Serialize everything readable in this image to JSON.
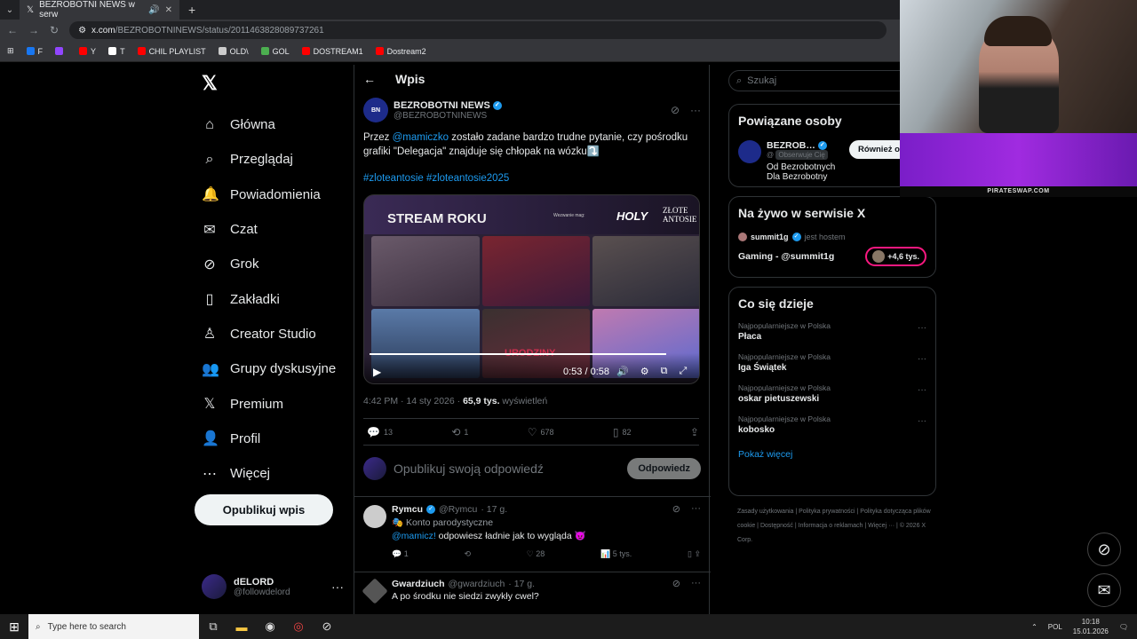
{
  "browser": {
    "tab_title": "BEZROBOTNI NEWS w serw",
    "url_host": "x.com",
    "url_path": "/BEZROBOTNINEWS/status/2011463828089737261",
    "bookmarks": [
      {
        "label": "F",
        "color": "#1877f2"
      },
      {
        "label": "",
        "color": "#9146ff"
      },
      {
        "label": "Y",
        "color": "#ff0000"
      },
      {
        "label": "T",
        "color": "#ffffff"
      },
      {
        "label": "CHIL PLAYLIST",
        "color": "#ff0000"
      },
      {
        "label": "OLD\\",
        "color": "#cccccc"
      },
      {
        "label": "GOL",
        "color": "#4caf50"
      },
      {
        "label": "DOSTREAM1",
        "color": "#ff0000"
      },
      {
        "label": "Dostream2",
        "color": "#ff0000"
      }
    ]
  },
  "nav": {
    "items": [
      {
        "icon": "⌂",
        "icon_name": "home-icon",
        "label": "Główna"
      },
      {
        "icon": "⌕",
        "icon_name": "search-icon",
        "label": "Przeglądaj"
      },
      {
        "icon": "🔔",
        "icon_name": "bell-icon",
        "label": "Powiadomienia"
      },
      {
        "icon": "✉",
        "icon_name": "mail-icon",
        "label": "Czat"
      },
      {
        "icon": "⊘",
        "icon_name": "grok-icon",
        "label": "Grok"
      },
      {
        "icon": "▯",
        "icon_name": "bookmark-icon",
        "label": "Zakładki"
      },
      {
        "icon": "♙",
        "icon_name": "creator-icon",
        "label": "Creator Studio"
      },
      {
        "icon": "👥",
        "icon_name": "groups-icon",
        "label": "Grupy dyskusyjne"
      },
      {
        "icon": "𝕏",
        "icon_name": "premium-icon",
        "label": "Premium"
      },
      {
        "icon": "👤",
        "icon_name": "profile-icon",
        "label": "Profil"
      },
      {
        "icon": "⋯",
        "icon_name": "more-icon",
        "label": "Więcej"
      }
    ],
    "post_button": "Opublikuj wpis",
    "me": {
      "name": "dELORD",
      "handle": "@followdelord"
    }
  },
  "post": {
    "header": "Wpis",
    "author": "BEZROBOTNI NEWS",
    "handle": "@BEZROBOTNINEWS",
    "avatar_text": "BN",
    "text_pre": "Przez ",
    "mention": "@mamiczko",
    "text_post": " zostało zadane bardzo trudne pytanie, czy pośrodku grafiki \"Delegacja\" znajduje się chłopak na wózku⤵️",
    "hashtags": "#zloteantosie #zloteantosie2025",
    "media": {
      "title": "STREAM ROKU",
      "subtitle": "Wezwanie mag:",
      "brand": "HOLY",
      "brand2": "ZŁOTE ANTOSIE",
      "overlay_text": "URODZINY",
      "time": "0:53 / 0:58",
      "progress": 0.91
    },
    "time": "4:42 PM · 14 sty 2026 · ",
    "views": "65,9 tys.",
    "views_label": " wyświetleń",
    "stats": {
      "replies": "13",
      "reposts": "1",
      "likes": "678",
      "bookmarks": "82"
    },
    "reply_placeholder": "Opublikuj swoją odpowiedź",
    "reply_button": "Odpowiedz"
  },
  "replies": [
    {
      "name": "Rymcu",
      "handle": "@Rymcu",
      "time": "· 17 g.",
      "sub": "🎭 Konto parodystyczne",
      "mention": "@mamicz!",
      "text": " odpowiesz ładnie jak to wygląda 😈",
      "stats": {
        "replies": "1",
        "reposts": "",
        "likes": "28",
        "views": "5 tys."
      }
    },
    {
      "name": "Gwardziuch",
      "handle": "@gwardziuch",
      "time": "· 17 g.",
      "text": "A po środku nie siedzi zwykły cwel?"
    }
  ],
  "right": {
    "search_placeholder": "Szukaj",
    "related": {
      "title": "Powiązane osoby",
      "name": "BEZROB…",
      "follows_you": "Obserwuje Cię",
      "button": "Również obser",
      "bio": "Od Bezrobotnych Dla Bezrobotny"
    },
    "live": {
      "title": "Na żywo w serwisie X",
      "host": "summit1g",
      "host_label": "jest hostem",
      "stream": "Gaming - @summit1g",
      "count": "+4,6 tys."
    },
    "trends": {
      "title": "Co się dzieje",
      "items": [
        {
          "context": "Najpopularniejsze w Polska",
          "name": "Płaca"
        },
        {
          "context": "Najpopularniejsze w Polska",
          "name": "Iga Świątek"
        },
        {
          "context": "Najpopularniejsze w Polska",
          "name": "oskar pietuszewski"
        },
        {
          "context": "Najpopularniejsze w Polska",
          "name": "kobosko"
        }
      ],
      "more": "Pokaż więcej"
    },
    "footer": [
      "Zasady użytkowania",
      "Polityka prywatności",
      "Polityka dotycząca plików cookie",
      "Dostępność",
      "Informacja o reklamach",
      "Więcej ···",
      "© 2026 X Corp."
    ]
  },
  "overlay": {
    "pirate": "PIRATESWAP.COM"
  },
  "taskbar": {
    "search": "Type here to search",
    "lang": "POL",
    "time": "10:18",
    "date": "15.01.2026"
  }
}
